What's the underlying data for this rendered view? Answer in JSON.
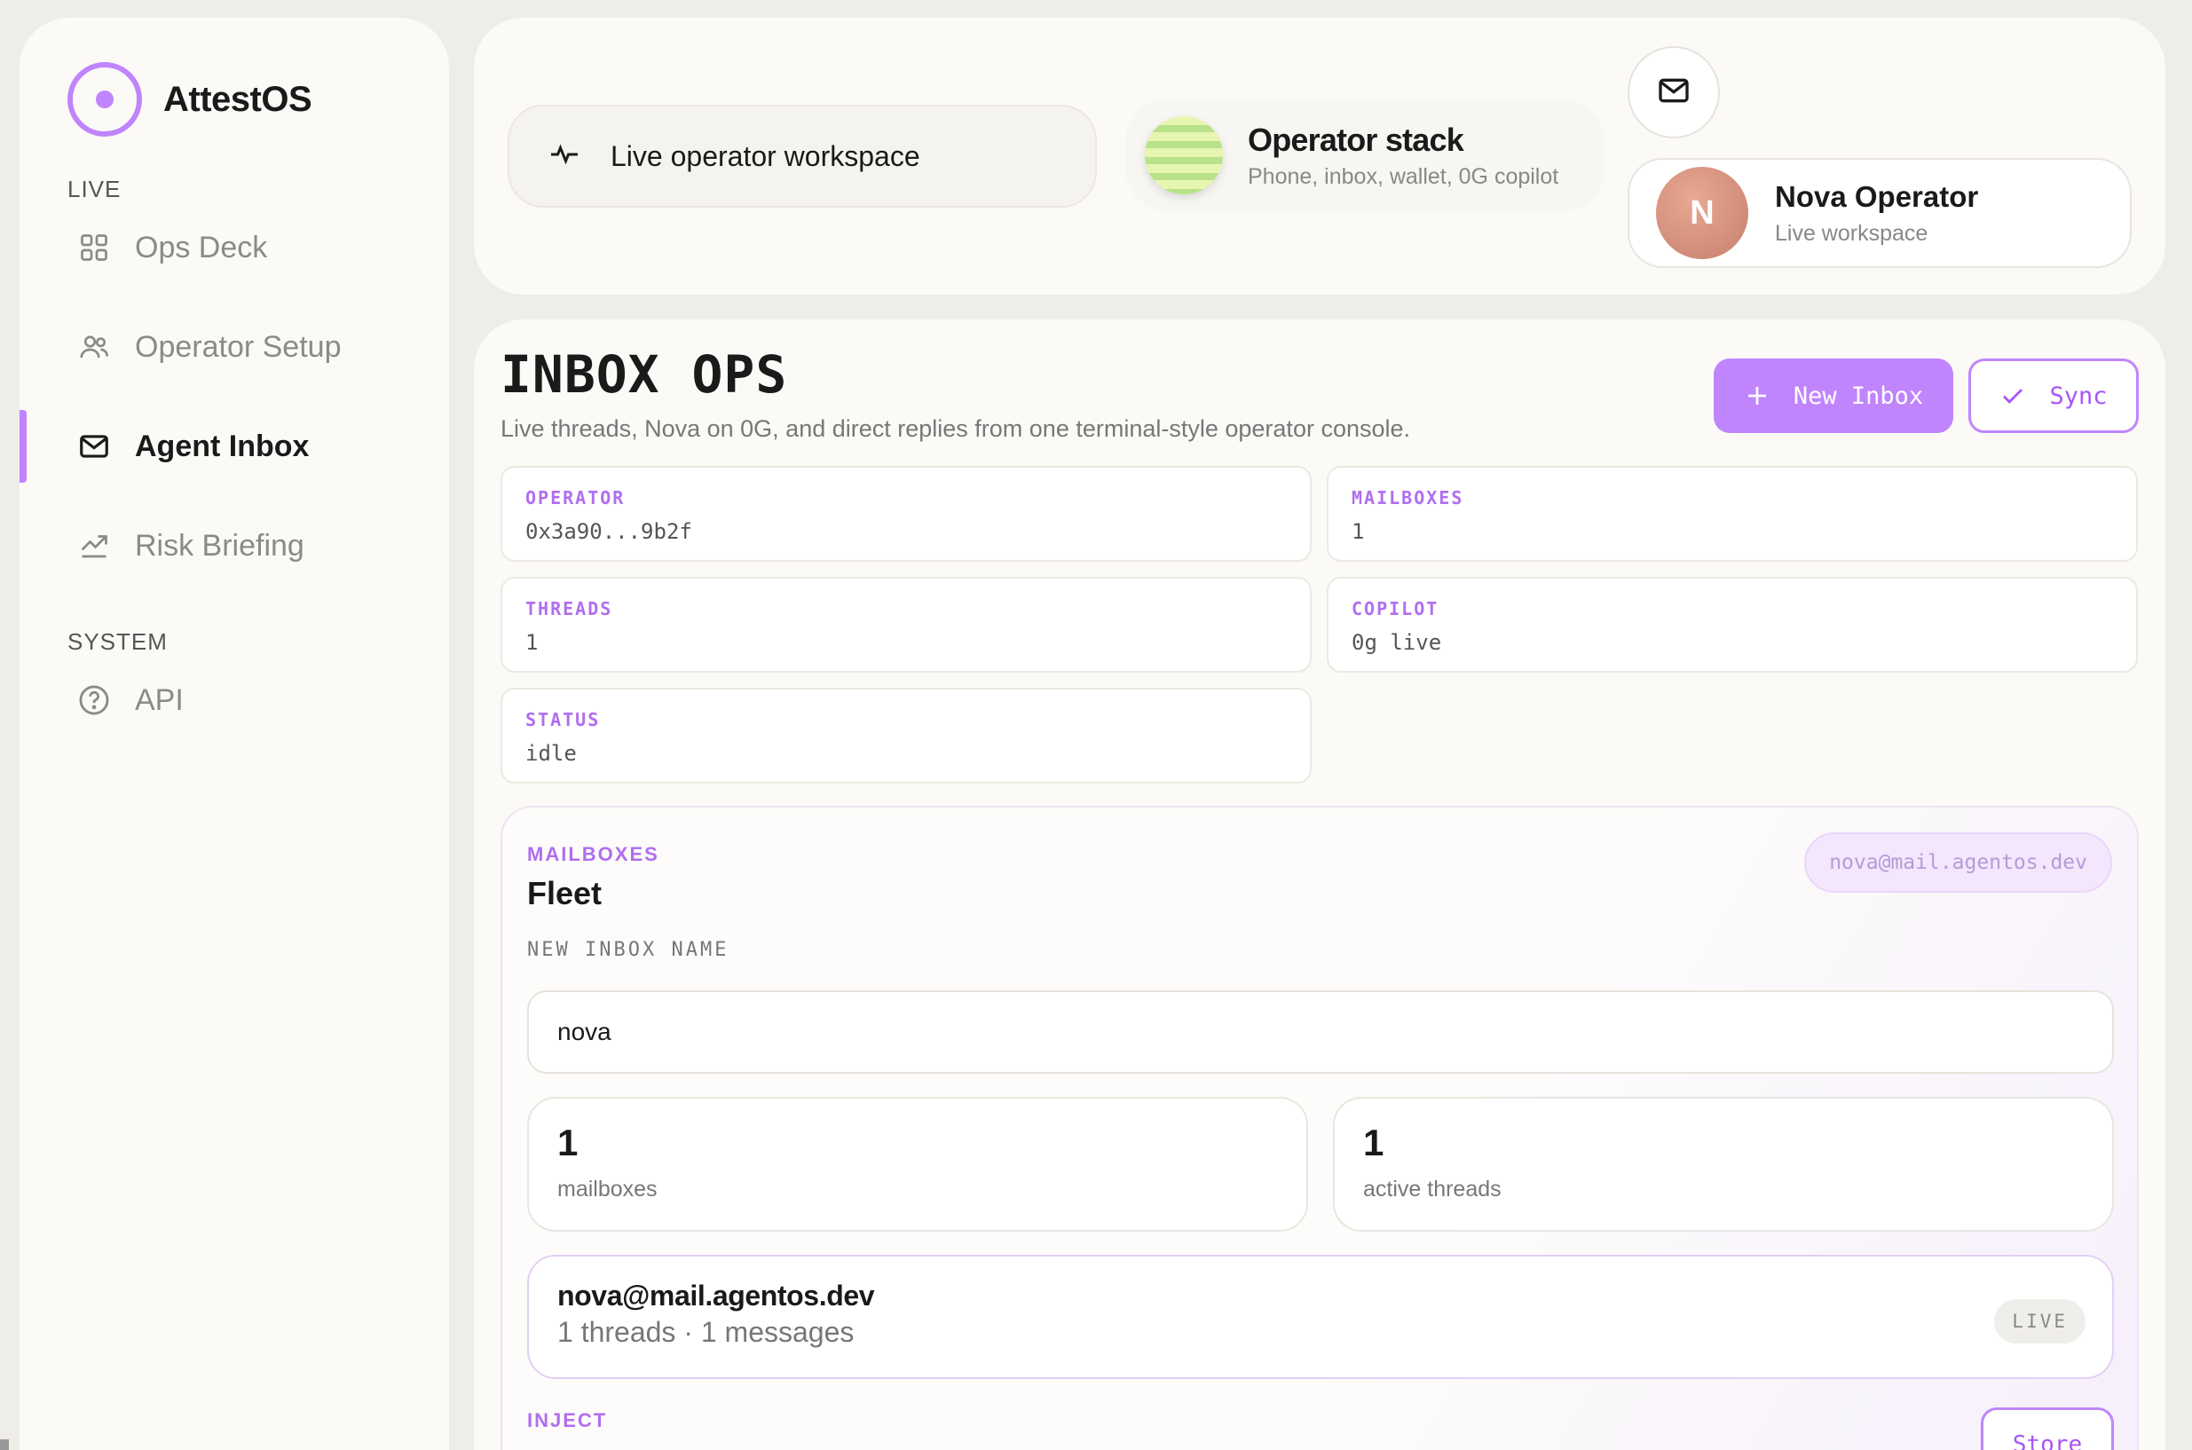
{
  "brand": {
    "name": "AttestOS"
  },
  "sidebar": {
    "sections": [
      {
        "label": "LIVE"
      },
      {
        "label": "SYSTEM"
      }
    ],
    "items": [
      {
        "label": "Ops Deck",
        "icon": "grid-icon"
      },
      {
        "label": "Operator Setup",
        "icon": "users-icon"
      },
      {
        "label": "Agent Inbox",
        "icon": "mail-icon",
        "active": true
      },
      {
        "label": "Risk Briefing",
        "icon": "trending-up-icon"
      },
      {
        "label": "API",
        "icon": "help-circle-icon"
      }
    ]
  },
  "topbar": {
    "workspace_label": "Live operator workspace",
    "stack_title": "Operator stack",
    "stack_subtitle": "Phone, inbox, wallet, 0G copilot",
    "user": {
      "initial": "N",
      "name": "Nova Operator",
      "subtitle": "Live workspace"
    }
  },
  "main": {
    "title": "INBOX OPS",
    "description": "Live threads, Nova on 0G, and direct replies from one terminal-style operator console.",
    "new_inbox_label": "New Inbox",
    "sync_label": "Sync",
    "stats": [
      {
        "key": "OPERATOR",
        "value": "0x3a90...9b2f"
      },
      {
        "key": "MAILBOXES",
        "value": "1"
      },
      {
        "key": "THREADS",
        "value": "1"
      },
      {
        "key": "COPILOT",
        "value": "0g live"
      },
      {
        "key": "STATUS",
        "value": "idle"
      }
    ]
  },
  "mailboxes": {
    "kicker": "MAILBOXES",
    "title": "Fleet",
    "address_chip": "nova@mail.agentos.dev",
    "input_label": "NEW INBOX NAME",
    "input_value": "nova",
    "metrics": [
      {
        "value": "1",
        "label": "mailboxes"
      },
      {
        "value": "1",
        "label": "active threads"
      }
    ],
    "thread": {
      "address": "nova@mail.agentos.dev",
      "summary": "1 threads · 1 messages",
      "badge": "LIVE"
    },
    "inject_label": "INJECT",
    "store_label": "Store"
  },
  "colors": {
    "accent": "#c084fc",
    "background": "#efede8",
    "panel": "#fbfaf7"
  }
}
